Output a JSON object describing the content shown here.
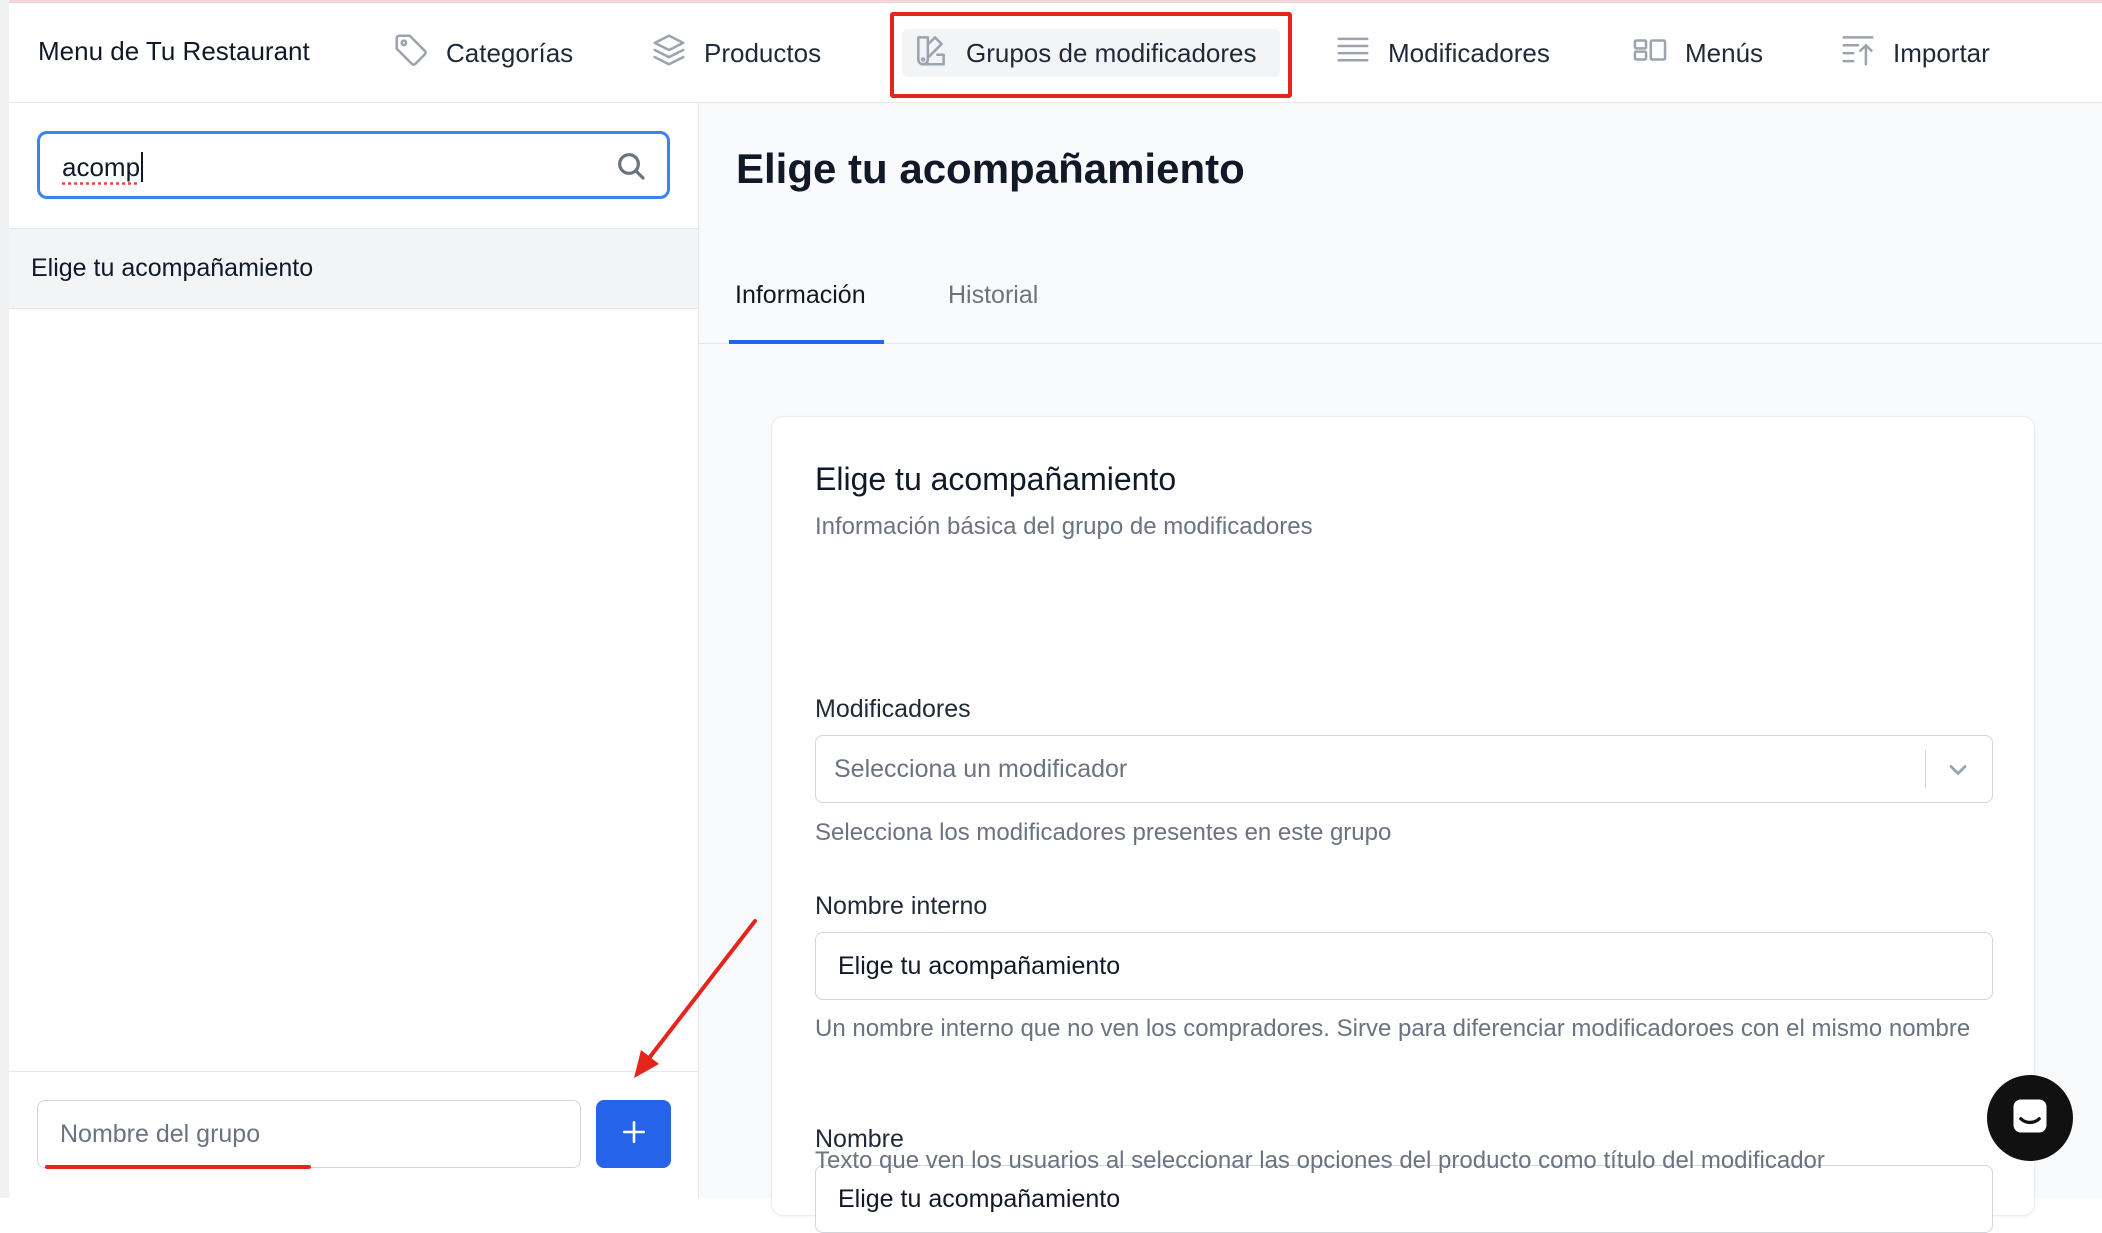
{
  "navbar": {
    "brand": "Menu de Tu Restaurant",
    "items": [
      {
        "label": "Categorías",
        "icon": "tag-icon"
      },
      {
        "label": "Productos",
        "icon": "layers-icon"
      },
      {
        "label": "Grupos de modificadores",
        "icon": "swatch-icon",
        "active": true
      },
      {
        "label": "Modificadores",
        "icon": "list-icon"
      },
      {
        "label": "Menús",
        "icon": "layout-icon"
      },
      {
        "label": "Importar",
        "icon": "import-icon"
      }
    ]
  },
  "sidebar": {
    "search": {
      "value": "acomp"
    },
    "items": [
      {
        "label": "Elige tu acompañamiento",
        "selected": true
      }
    ],
    "new_group": {
      "placeholder": "Nombre del grupo",
      "add_symbol": "+"
    }
  },
  "main": {
    "title": "Elige tu acompañamiento",
    "tabs": [
      {
        "label": "Información",
        "active": true
      },
      {
        "label": "Historial"
      }
    ],
    "card": {
      "title": "Elige tu acompañamiento",
      "subtitle": "Información básica del grupo de modificadores",
      "modifiers": {
        "label": "Modificadores",
        "placeholder": "Selecciona un modificador",
        "hint": "Selecciona los modificadores presentes en este grupo"
      },
      "internal_name": {
        "label": "Nombre interno",
        "value": "Elige tu acompañamiento",
        "hint": "Un nombre interno que no ven los compradores. Sirve para diferenciar modificadoroes con el mismo nombre"
      },
      "name": {
        "label": "Nombre",
        "value": "Elige tu acompañamiento",
        "hint": "Texto que ven los usuarios al seleccionar las opciones del producto como título del modificador"
      }
    }
  },
  "colors": {
    "accent": "#2563eb",
    "annotation": "#e4251d"
  }
}
